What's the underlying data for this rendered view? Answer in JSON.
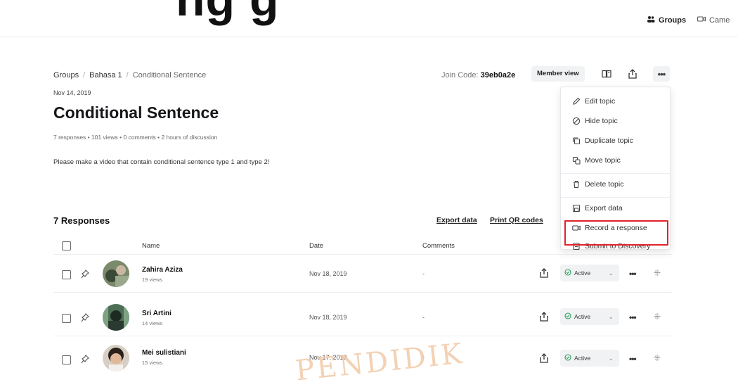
{
  "topbar": {
    "cropped_title": "ng   g",
    "nav": [
      {
        "label": "Groups",
        "icon": "groups-icon"
      },
      {
        "label": "Came",
        "icon": "camera-icon"
      }
    ]
  },
  "breadcrumb": [
    "Groups",
    "Bahasa 1",
    "Conditional Sentence"
  ],
  "breadcrumb_sep": "/",
  "header_actions": {
    "join_code_label": "Join Code:",
    "join_code_value": "39eb0a2e",
    "member_view_label": "Member view",
    "more_label": "•••"
  },
  "topic": {
    "date": "Nov 14, 2019",
    "title": "Conditional Sentence",
    "stats": "7 responses • 101 views • 0 comments • 2 hours of discussion",
    "prompt": "Please make a video that contain conditional sentence type 1 and type 2!"
  },
  "responses": {
    "heading": "7 Responses",
    "export_label": "Export data",
    "print_label": "Print QR codes",
    "columns": {
      "name": "Name",
      "date": "Date",
      "comments": "Comments"
    },
    "rows": [
      {
        "name": "Zahira Aziza",
        "views": "19 views",
        "date": "Nov 18, 2019",
        "comments": "-",
        "status": "Active",
        "more": "•••",
        "drag": "⁜"
      },
      {
        "name": "Sri Artini",
        "views": "14 views",
        "date": "Nov 18, 2019",
        "comments": "-",
        "status": "Active",
        "more": "•••",
        "drag": "⁜"
      },
      {
        "name": "Mei sulistiani",
        "views": "15 views",
        "date": "Nov 17, 2019",
        "comments": "-",
        "status": "Active",
        "more": "•••",
        "drag": "⁜"
      }
    ]
  },
  "menu": {
    "items": [
      {
        "label": "Edit topic",
        "icon": "pencil-icon"
      },
      {
        "label": "Hide topic",
        "icon": "hide-icon"
      },
      {
        "label": "Duplicate topic",
        "icon": "duplicate-icon"
      },
      {
        "label": "Move topic",
        "icon": "move-icon"
      },
      {
        "label": "Delete topic",
        "icon": "trash-icon"
      },
      {
        "label": "Export data",
        "icon": "export-icon"
      },
      {
        "label": "Record a response",
        "icon": "camera-icon"
      },
      {
        "label": "Submit to Discovery",
        "icon": "discovery-icon"
      }
    ],
    "highlighted_item": "Submit to Discovery",
    "highlight_color": "#e0232a"
  },
  "watermark": {
    "text": "PENDIDIK"
  },
  "colors": {
    "active_green": "#2e9e5b",
    "text_dark": "#15171a"
  }
}
